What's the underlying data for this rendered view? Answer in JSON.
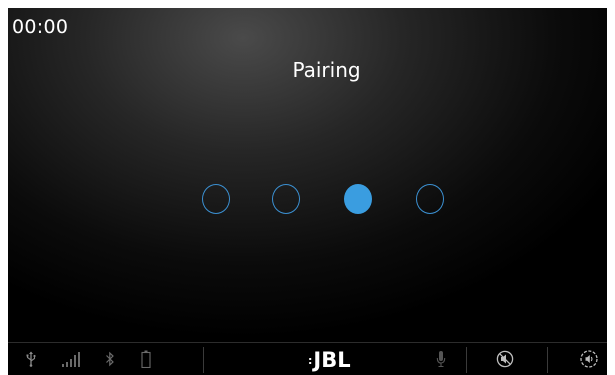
{
  "status": {
    "time": "00:00"
  },
  "main": {
    "title": "Pairing",
    "progress": {
      "total_steps": 4,
      "active_step": 3
    }
  },
  "statusbar": {
    "brand": "JBL",
    "icons": [
      "usb-icon",
      "signal-icon",
      "bluetooth-icon",
      "battery-icon",
      "microphone-icon",
      "mute-icon",
      "volume-icon"
    ]
  },
  "colors": {
    "accent": "#3a9de0",
    "ring": "#3b8fd0",
    "text": "#ffffff",
    "dim_icon": "#6a6a6a"
  }
}
